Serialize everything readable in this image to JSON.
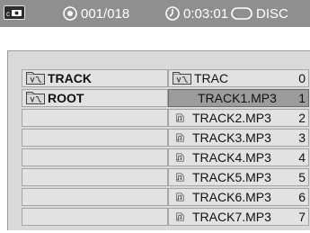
{
  "status": {
    "camera_icon": "camera-icon",
    "track_counter": "001/018",
    "time": "0:03:01",
    "source": "DISC"
  },
  "folders": [
    {
      "label": "TRACK",
      "icon": "folder-icon"
    },
    {
      "label": "ROOT",
      "icon": "folder-icon"
    },
    {
      "label": ""
    },
    {
      "label": ""
    },
    {
      "label": ""
    },
    {
      "label": ""
    },
    {
      "label": ""
    },
    {
      "label": ""
    }
  ],
  "files": [
    {
      "label": "TRAC",
      "index": "0",
      "icon": "folder-icon"
    },
    {
      "label": "TRACK1.MP3",
      "index": "1",
      "selected": true
    },
    {
      "label": "TRACK2.MP3",
      "index": "2",
      "icon": "music-file-icon"
    },
    {
      "label": "TRACK3.MP3",
      "index": "3",
      "icon": "music-file-icon"
    },
    {
      "label": "TRACK4.MP3",
      "index": "4",
      "icon": "music-file-icon"
    },
    {
      "label": "TRACK5.MP3",
      "index": "5",
      "icon": "music-file-icon"
    },
    {
      "label": "TRACK6.MP3",
      "index": "6",
      "icon": "music-file-icon"
    },
    {
      "label": "TRACK7.MP3",
      "index": "7",
      "icon": "music-file-icon"
    }
  ],
  "colors": {
    "status_bar": "#8f8f8f",
    "panel": "#d9d9d9",
    "row": "#e2e2e2",
    "selected_row": "#9c9c9c"
  }
}
